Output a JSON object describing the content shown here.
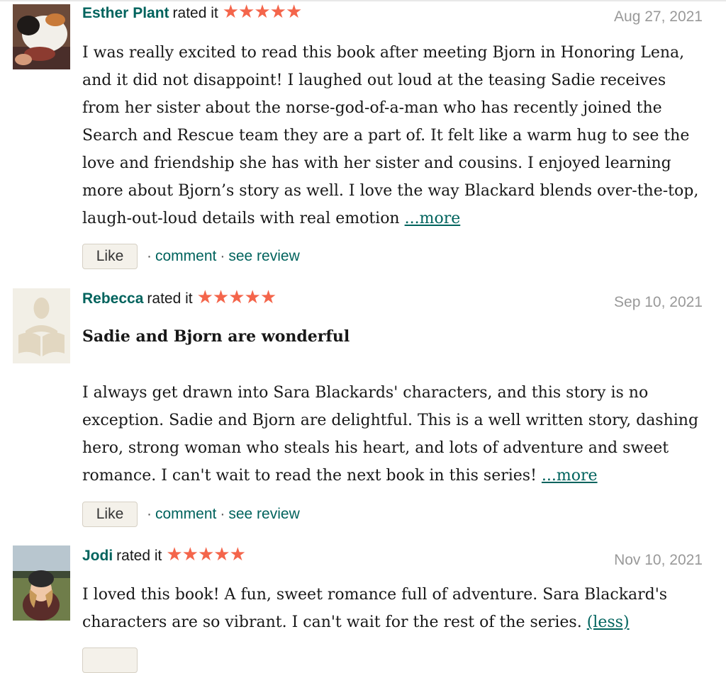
{
  "reviews": [
    {
      "name": "Esther Plant",
      "rated_label": "rated it",
      "stars": "★★★★★",
      "rating": 5,
      "date": "Aug 27, 2021",
      "title": "",
      "text": "I was really excited to read this book after meeting Bjorn in Honoring Lena, and it did not disappoint! I laughed out loud at the teasing Sadie receives from her sister about the norse-god-of-a-man who has recently joined the Search and Rescue team they are a part of. It felt like a warm hug to see the love and friendship she has with her sister and cousins. I enjoyed learning more about Bjorn’s story as well. I love the way Blackard blends over-the-top, laugh-out-loud details with real emotion",
      "more_label": "...more",
      "like_label": "Like",
      "comment_label": "comment",
      "see_review_label": "see review",
      "separator": "·"
    },
    {
      "name": "Rebecca",
      "rated_label": "rated it",
      "stars": "★★★★★",
      "rating": 5,
      "date": "Sep 10, 2021",
      "title": "Sadie and Bjorn are wonderful",
      "text": "I always get drawn into Sara Blackards' characters, and this story is no exception. Sadie and Bjorn are delightful. This is a well written story, dashing hero, strong woman who steals his heart, and lots of adventure and sweet romance. I can't wait to read the next book in this series!",
      "more_label": "...more",
      "like_label": "Like",
      "comment_label": "comment",
      "see_review_label": "see review",
      "separator": "·"
    },
    {
      "name": "Jodi",
      "rated_label": "rated it",
      "stars": "★★★★★",
      "rating": 5,
      "date": "Nov 10, 2021",
      "title": "",
      "text": "I loved this book! A fun, sweet romance full of adventure. Sara Blackard's characters are so vibrant. I can't wait for the rest of the series.",
      "more_label": "(less)"
    }
  ],
  "colors": {
    "link": "#00635d",
    "star": "#f4654b",
    "date": "#999999",
    "like_bg": "#f4f1ea"
  }
}
